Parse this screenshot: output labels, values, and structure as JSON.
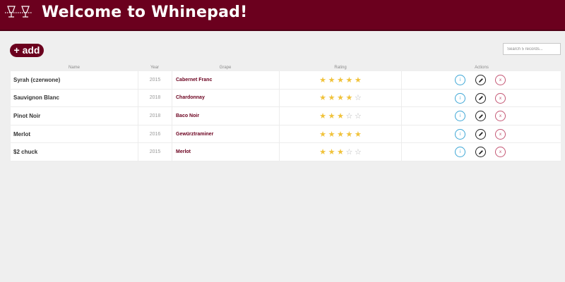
{
  "header": {
    "title": "Welcome to Whinepad!",
    "logo_icon": "wine-glasses-icon"
  },
  "toolbar": {
    "add_label": "+ add",
    "search_placeholder": "Search 5 records..."
  },
  "columns": {
    "name": "Name",
    "year": "Year",
    "grape": "Grape",
    "rating": "Rating",
    "actions": "Actions"
  },
  "rows": [
    {
      "name": "Syrah (czerwone)",
      "year": "2015",
      "grape": "Cabernet Franc",
      "rating": 5
    },
    {
      "name": "Sauvignon Blanc",
      "year": "2018",
      "grape": "Chardonnay",
      "rating": 4
    },
    {
      "name": "Pinot Noir",
      "year": "2018",
      "grape": "Baco Noir",
      "rating": 3
    },
    {
      "name": "Merlot",
      "year": "2016",
      "grape": "Gewürztraminer",
      "rating": 5
    },
    {
      "name": "$2 chuck",
      "year": "2015",
      "grape": "Merlot",
      "rating": 3
    }
  ],
  "rating_max": 5,
  "actions": {
    "info_label": "i",
    "edit_icon": "pencil-icon",
    "delete_label": "x"
  },
  "colors": {
    "brand": "#6b001e",
    "star": "#f0c23a",
    "info": "#3ea7d6",
    "delete": "#c45774"
  }
}
